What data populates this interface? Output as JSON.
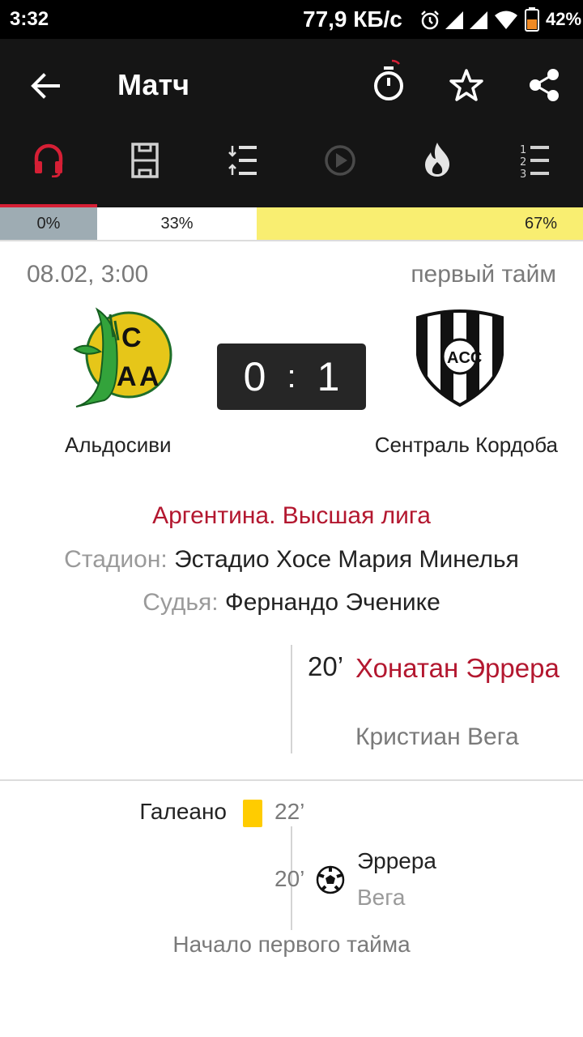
{
  "status_bar": {
    "time": "3:32",
    "network_speed": "77,9 КБ/с",
    "battery": "42%"
  },
  "toolbar": {
    "title": "Матч",
    "tabs": [
      {
        "icon": "headset-icon",
        "active": true
      },
      {
        "icon": "field-lineup-icon",
        "active": false
      },
      {
        "icon": "events-list-icon",
        "active": false
      },
      {
        "icon": "play-video-icon",
        "active": false,
        "disabled": true
      },
      {
        "icon": "fire-icon",
        "active": false
      },
      {
        "icon": "standings-icon",
        "active": false
      }
    ]
  },
  "vote_bar": {
    "home_pct": "0%",
    "draw_pct": "33%",
    "away_pct": "67%"
  },
  "match": {
    "datetime": "08.02, 3:00",
    "period": "первый тайм",
    "home_team": "Альдосиви",
    "away_team": "Сентраль Кордоба",
    "home_score": "0",
    "score_separator": ":",
    "away_score": "1",
    "league": "Аргентина. Высшая лига",
    "stadium_label": "Стадион:",
    "stadium": "Эстадио Хосе Мария Минелья",
    "referee_label": "Судья:",
    "referee": "Фернандо Эченике"
  },
  "highlight_goal": {
    "minute": "20’",
    "scorer": "Хонатан Эррера",
    "assist": "Кристиан Вега"
  },
  "timeline": {
    "card": {
      "player": "Галеано",
      "minute": "22’"
    },
    "goal": {
      "minute": "20’",
      "scorer": "Эррера",
      "assist": "Вега"
    },
    "kickoff": "Начало первого тайма"
  },
  "colors": {
    "accent": "#d61f35",
    "league": "#b3172f",
    "toolbar": "#151515",
    "vote_home": "#9eacb3",
    "vote_away": "#f9ee71",
    "yellow_card": "#ffcc00"
  }
}
